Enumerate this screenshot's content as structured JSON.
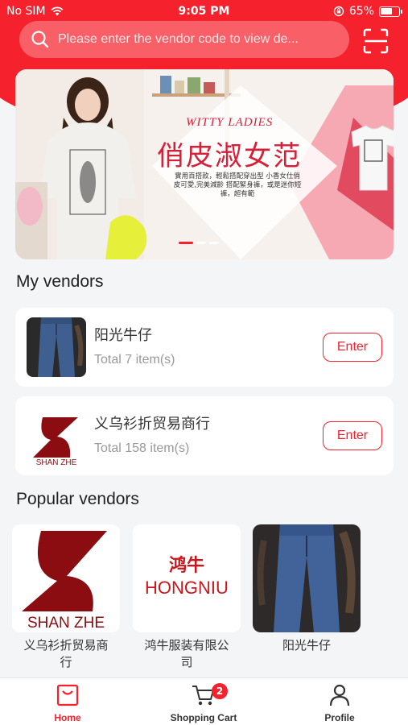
{
  "status_bar": {
    "carrier": "No SIM",
    "time": "9:05 PM",
    "battery": "65%",
    "battery_level": 0.65
  },
  "search": {
    "placeholder": "Please enter the vendor code to view de..."
  },
  "banner": {
    "title_en": "WITTY LADIES",
    "title_cn": "俏皮淑女范",
    "desc": "實用百搭款，輕鬆搭配穿出型 小香女仕俏皮可愛,完美減齡 搭配緊身褲，或是迷你短褲，超有範",
    "slides": 3,
    "active_slide": 1
  },
  "my_vendors": {
    "title": "My vendors",
    "items": [
      {
        "name": "阳光牛仔",
        "count": "Total 7 item(s)",
        "enter": "Enter",
        "thumb": "jeans"
      },
      {
        "name": "义乌衫折贸易商行",
        "count": "Total 158 item(s)",
        "enter": "Enter",
        "thumb": "shanzhe",
        "logo_text": "SHAN ZHE"
      }
    ]
  },
  "popular_vendors": {
    "title": "Popular vendors",
    "items": [
      {
        "name": "义乌衫折贸易商行",
        "thumb": "shanzhe",
        "logo_text": "SHAN ZHE"
      },
      {
        "name": "鸿牛服装有限公司",
        "thumb": "hongniu",
        "logo_cn": "鸿牛",
        "logo_en": "HONGNIU"
      },
      {
        "name": "阳光牛仔",
        "thumb": "jeans"
      }
    ]
  },
  "tabbar": {
    "items": [
      {
        "label": "Home",
        "icon": "home-bag-icon",
        "active": true
      },
      {
        "label": "Shopping Cart",
        "icon": "cart-icon",
        "badge": "2"
      },
      {
        "label": "Profile",
        "icon": "person-icon"
      }
    ]
  },
  "colors": {
    "primary": "#f5222d",
    "logo_dark_red": "#8b0d12",
    "background": "#f4f5f7"
  }
}
